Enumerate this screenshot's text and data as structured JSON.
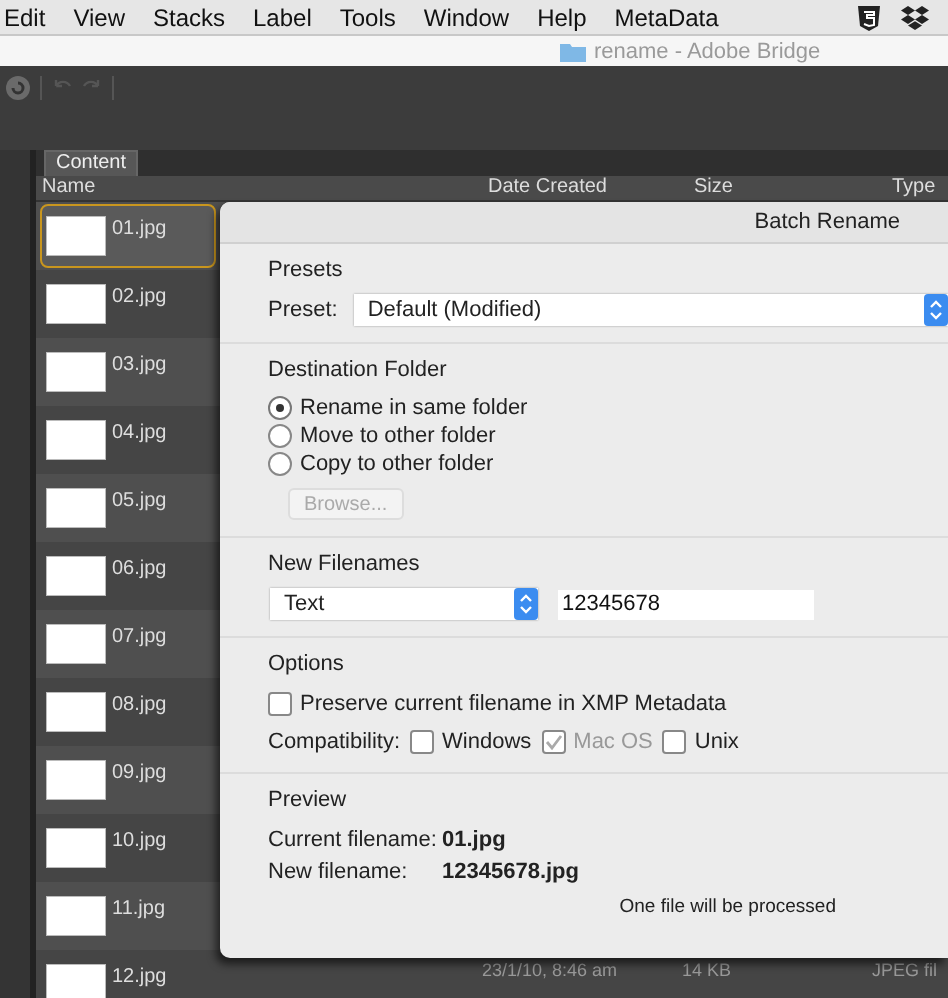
{
  "menu": [
    "Edit",
    "View",
    "Stacks",
    "Label",
    "Tools",
    "Window",
    "Help",
    "MetaData"
  ],
  "window": {
    "title": "rename - Adobe Bridge"
  },
  "tabs": [
    {
      "label": "Content",
      "selected": true
    }
  ],
  "columns": [
    "Name",
    "Date Created",
    "Size",
    "Type"
  ],
  "files": [
    {
      "name": "01.jpg",
      "selected": true
    },
    {
      "name": "02.jpg",
      "selected": false
    },
    {
      "name": "03.jpg",
      "selected": false
    },
    {
      "name": "04.jpg",
      "selected": false
    },
    {
      "name": "05.jpg",
      "selected": false
    },
    {
      "name": "06.jpg",
      "selected": false
    },
    {
      "name": "07.jpg",
      "selected": false
    },
    {
      "name": "08.jpg",
      "selected": false
    },
    {
      "name": "09.jpg",
      "selected": false
    },
    {
      "name": "10.jpg",
      "selected": false
    },
    {
      "name": "11.jpg",
      "selected": false
    },
    {
      "name": "12.jpg",
      "selected": false,
      "date": "23/1/10, 8:46 am",
      "size": "14 KB",
      "type": "JPEG fil"
    }
  ],
  "dialog": {
    "title": "Batch Rename",
    "presets": {
      "heading": "Presets",
      "label": "Preset:",
      "value": "Default (Modified)"
    },
    "destination": {
      "heading": "Destination Folder",
      "options": [
        {
          "label": "Rename in same folder",
          "selected": true
        },
        {
          "label": "Move to other folder",
          "selected": false
        },
        {
          "label": "Copy to other folder",
          "selected": false
        }
      ],
      "browse": {
        "label": "Browse...",
        "disabled": true
      }
    },
    "new_filenames": {
      "heading": "New Filenames",
      "type": "Text",
      "text": "12345678"
    },
    "options": {
      "heading": "Options",
      "preserve": {
        "label": "Preserve current filename in XMP Metadata",
        "checked": false
      },
      "compatibility_label": "Compatibility:",
      "compatibility": [
        {
          "label": "Windows",
          "checked": false,
          "disabled": false
        },
        {
          "label": "Mac OS",
          "checked": true,
          "disabled": true
        },
        {
          "label": "Unix",
          "checked": false,
          "disabled": false
        }
      ]
    },
    "preview": {
      "heading": "Preview",
      "current_label": "Current filename:",
      "current_value": "01.jpg",
      "new_label": "New filename:",
      "new_value": "12345678.jpg",
      "note": "One file will be processed"
    }
  }
}
